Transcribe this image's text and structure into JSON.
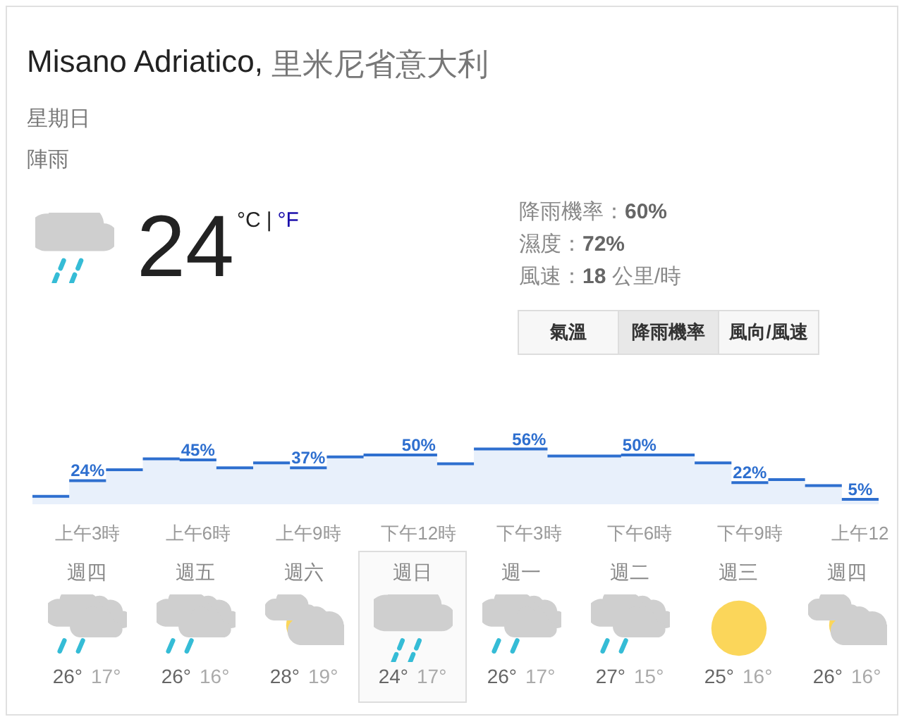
{
  "location": {
    "city": "Misano Adriatico,",
    "region": "里米尼省意大利"
  },
  "day": "星期日",
  "condition": "陣雨",
  "current": {
    "kind": "rain",
    "temperature": "24",
    "units": [
      {
        "label": "°C",
        "selected": true
      },
      {
        "label": "°F",
        "selected": false
      }
    ],
    "separator": "|"
  },
  "details": [
    {
      "label": "降雨機率：",
      "value": "60%"
    },
    {
      "label": "濕度：",
      "value": "72%"
    },
    {
      "label": "風速：",
      "value": "18",
      "unit": " 公里/時"
    }
  ],
  "tabs": [
    {
      "label": "氣溫",
      "selected": false
    },
    {
      "label": "降雨機率",
      "selected": true
    },
    {
      "label": "風向/風速",
      "selected": false
    }
  ],
  "precipitation": {
    "labels": [
      "24%",
      "45%",
      "37%",
      "50%",
      "56%",
      "50%",
      "22%",
      "5%"
    ],
    "times": [
      "上午3時",
      "上午6時",
      "上午9時",
      "下午12時",
      "下午3時",
      "下午6時",
      "下午9時",
      "上午12"
    ]
  },
  "forecast": [
    {
      "day": "週四",
      "kind": "cloudy_rain",
      "high": "26°",
      "low": "17°",
      "selected": false
    },
    {
      "day": "週五",
      "kind": "cloudy_rain",
      "high": "26°",
      "low": "16°",
      "selected": false
    },
    {
      "day": "週六",
      "kind": "partly_cloudy",
      "high": "28°",
      "low": "19°",
      "selected": false
    },
    {
      "day": "週日",
      "kind": "rain",
      "high": "24°",
      "low": "17°",
      "selected": true
    },
    {
      "day": "週一",
      "kind": "cloudy_rain",
      "high": "26°",
      "low": "17°",
      "selected": false
    },
    {
      "day": "週二",
      "kind": "cloudy_rain",
      "high": "27°",
      "low": "15°",
      "selected": false
    },
    {
      "day": "週三",
      "kind": "sunny",
      "high": "25°",
      "low": "16°",
      "selected": false
    },
    {
      "day": "週四",
      "kind": "partly_cloudy",
      "high": "26°",
      "low": "16°",
      "selected": false
    }
  ]
}
